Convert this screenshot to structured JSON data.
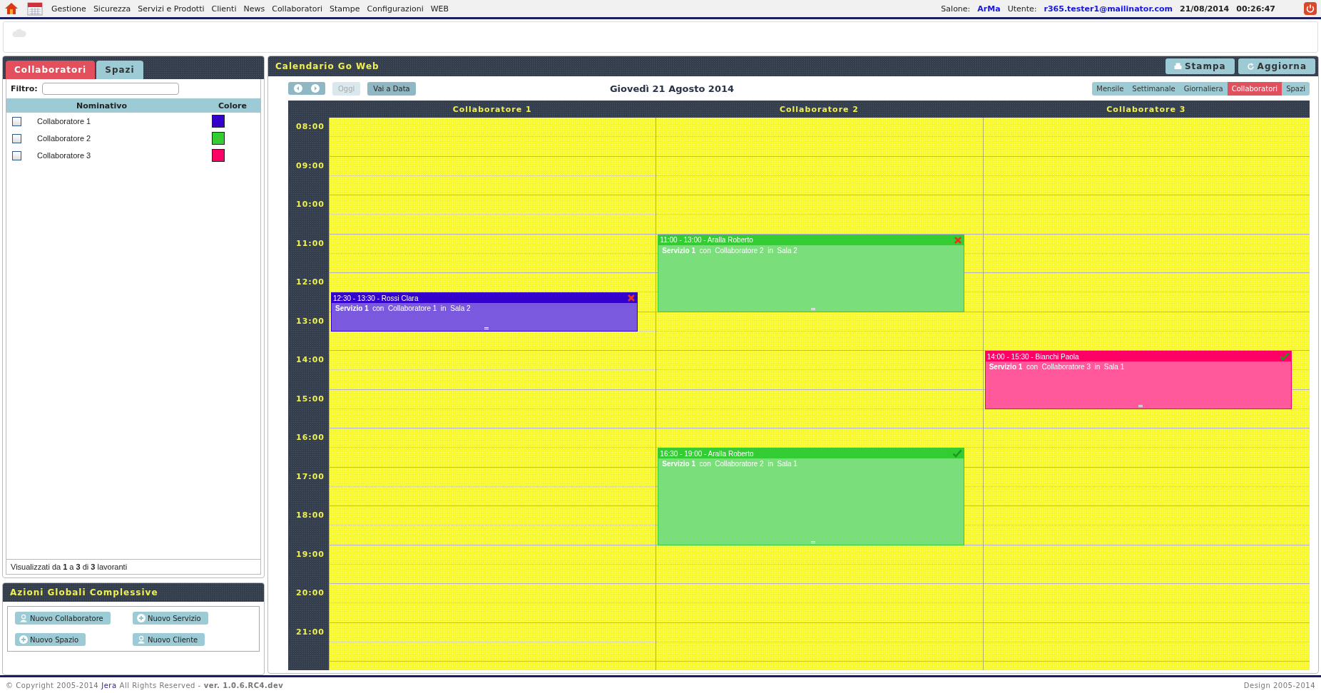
{
  "top_bar": {
    "menu": [
      "Gestione",
      "Sicurezza",
      "Servizi e Prodotti",
      "Clienti",
      "News",
      "Collaboratori",
      "Stampe",
      "Configurazioni",
      "WEB"
    ],
    "salone_label": "Salone:",
    "salone": "ArMa",
    "utente_label": "Utente:",
    "utente": "r365.tester1@mailinator.com",
    "date": "21/08/2014",
    "time": "00:26:47"
  },
  "left_panel": {
    "tabs": [
      {
        "label": "Collaboratori",
        "selected": true
      },
      {
        "label": "Spazi",
        "selected": false
      }
    ],
    "filter_label": "Filtro:",
    "columns": [
      "Nominativo",
      "Colore"
    ],
    "rows": [
      {
        "name": "Collaboratore 1",
        "checked": false,
        "color": "#3300cc"
      },
      {
        "name": "Collaboratore 2",
        "checked": false,
        "color": "#33cc33"
      },
      {
        "name": "Collaboratore 3",
        "checked": false,
        "color": "#ff0066"
      }
    ],
    "summary": "Visualizzati da **1** a **3** di **3** lavoranti"
  },
  "actions_panel": {
    "title": "Azioni Globali Complessive",
    "buttons": [
      {
        "label": "Nuovo Collaboratore",
        "kind": "person"
      },
      {
        "label": "Nuovo Servizio",
        "kind": "plus"
      },
      {
        "label": "Nuovo Spazio",
        "kind": "plus"
      },
      {
        "label": "Nuovo Cliente",
        "kind": "person"
      }
    ]
  },
  "calendar": {
    "title": "Calendario Go Web",
    "buttons": [
      {
        "label": "Stampa",
        "kind": "print"
      },
      {
        "label": "Aggiorna",
        "kind": "refresh"
      }
    ],
    "today_button": {
      "label": "Oggi",
      "disabled": true
    },
    "goto_button": "Vai a Data",
    "date_title": "Giovedì 21 Agosto 2014",
    "views": [
      {
        "label": "Mensile",
        "selected": false
      },
      {
        "label": "Settimanale",
        "selected": false
      },
      {
        "label": "Giornaliera",
        "selected": false
      },
      {
        "label": "Collaboratori",
        "selected": true
      },
      {
        "label": "Spazi",
        "selected": false
      }
    ],
    "hours": [
      "08:00",
      "09:00",
      "10:00",
      "11:00",
      "12:00",
      "13:00",
      "14:00",
      "15:00",
      "16:00",
      "17:00",
      "18:00",
      "19:00",
      "20:00",
      "21:00"
    ],
    "columns": [
      {
        "name": "Collaboratore 1",
        "events": [
          {
            "header": "12:30 - 13:30 - Rossi Clara",
            "body": "**Servizio 1**  con  Collaboratore 1  in  Sala 2",
            "color": "#3300cc",
            "confirmed": false
          }
        ]
      },
      {
        "name": "Collaboratore 2",
        "events": [
          {
            "header": "11:00 - 13:00 - Aralla Roberto",
            "body": "**Servizio 1**  con  Collaboratore 2  in  Sala 2",
            "color": "#33cc33",
            "confirmed": false
          },
          {
            "header": "16:30 - 19:00 - Aralla Roberto",
            "body": "**Servizio 1**  con  Collaboratore 2  in  Sala 1",
            "color": "#33cc33",
            "confirmed": true
          }
        ]
      },
      {
        "name": "Collaboratore 3",
        "events": [
          {
            "header": "14:00 - 15:30 - Bianchi Paola",
            "body": "**Servizio 1**  con  Collaboratore 3  in  Sala 1",
            "color": "#ff0066",
            "confirmed": true
          }
        ]
      }
    ]
  },
  "footer": {
    "copyright": "© Copyright 2005-2014",
    "company": "Jera",
    "rights": "All Rights Reserved -",
    "version": "ver. 1.0.6.RC4.dev",
    "design": "Design 2005-2014"
  }
}
